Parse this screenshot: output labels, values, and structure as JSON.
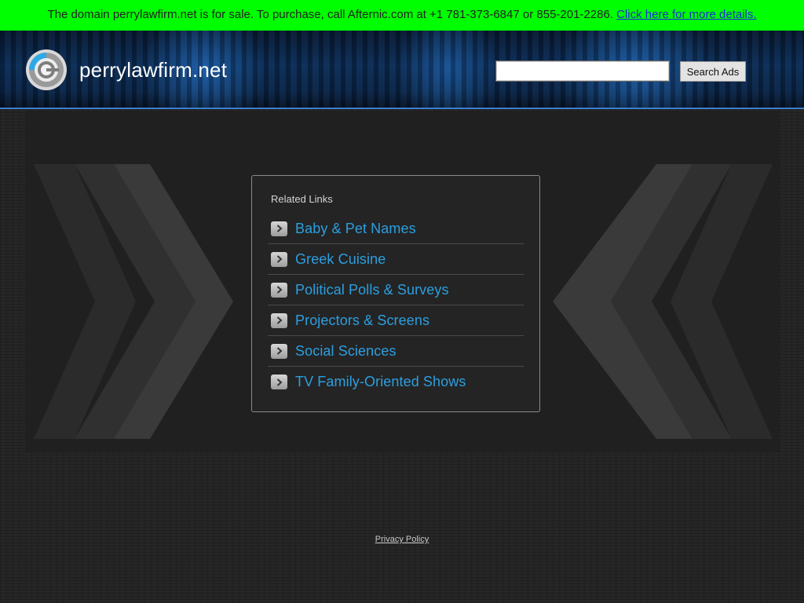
{
  "banner": {
    "text": "The domain perrylawfirm.net is for sale. To purchase, call Afternic.com at +1 781-373-6847 or 855-201-2286.",
    "link_label": "Click here for more details."
  },
  "header": {
    "site_name": "perrylawfirm.net",
    "logo_icon": "target-logo-icon",
    "search": {
      "value": "",
      "placeholder": "",
      "button_label": "Search Ads"
    }
  },
  "related": {
    "heading": "Related Links",
    "items": [
      {
        "label": "Baby & Pet Names",
        "icon": "chevron-right-icon"
      },
      {
        "label": "Greek Cuisine",
        "icon": "chevron-right-icon"
      },
      {
        "label": "Political Polls & Surveys",
        "icon": "chevron-right-icon"
      },
      {
        "label": "Projectors & Screens",
        "icon": "chevron-right-icon"
      },
      {
        "label": "Social Sciences",
        "icon": "chevron-right-icon"
      },
      {
        "label": "TV Family-Oriented Shows",
        "icon": "chevron-right-icon"
      }
    ]
  },
  "footer": {
    "privacy_label": "Privacy Policy"
  },
  "colors": {
    "banner_bg": "#00ff00",
    "link_blue": "#2b9fe0",
    "header_accent": "#3b7fd0",
    "page_bg": "#262626"
  }
}
